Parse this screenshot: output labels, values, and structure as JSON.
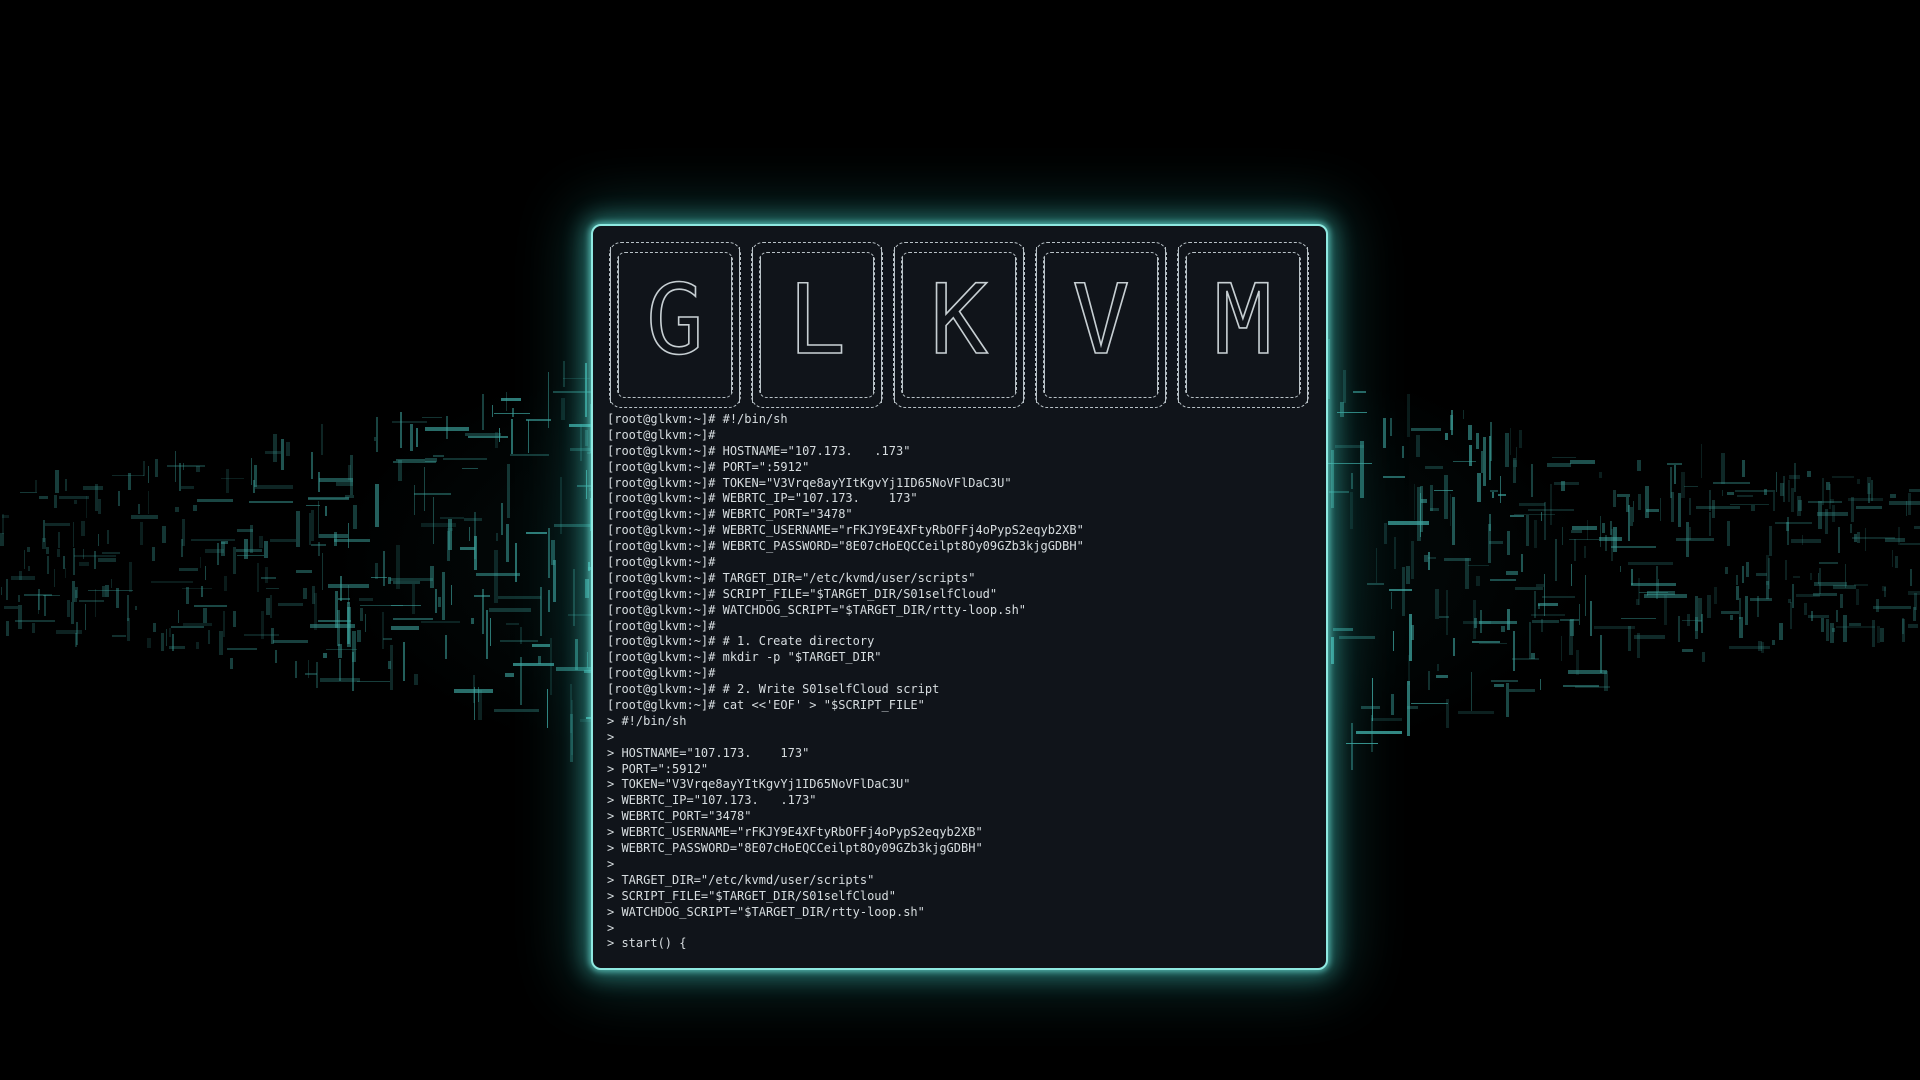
{
  "background": {
    "accent": "#3fa9a3",
    "glow": "#8fe9e1"
  },
  "terminal": {
    "background": "#10141a",
    "banner_letters": [
      "G",
      "L",
      "K",
      "V",
      "M"
    ],
    "lines": [
      "[root@glkvm:~]# #!/bin/sh",
      "[root@glkvm:~]#",
      "[root@glkvm:~]# HOSTNAME=\"107.173.   .173\"",
      "[root@glkvm:~]# PORT=\":5912\"",
      "[root@glkvm:~]# TOKEN=\"V3Vrqe8ayYItKgvYj1ID65NoVFlDaC3U\"",
      "[root@glkvm:~]# WEBRTC_IP=\"107.173.    173\"",
      "[root@glkvm:~]# WEBRTC_PORT=\"3478\"",
      "[root@glkvm:~]# WEBRTC_USERNAME=\"rFKJY9E4XFtyRbOFFj4oPypS2eqyb2XB\"",
      "[root@glkvm:~]# WEBRTC_PASSWORD=\"8E07cHoEQCCeilpt8Oy09GZb3kjgGDBH\"",
      "[root@glkvm:~]#",
      "[root@glkvm:~]# TARGET_DIR=\"/etc/kvmd/user/scripts\"",
      "[root@glkvm:~]# SCRIPT_FILE=\"$TARGET_DIR/S01selfCloud\"",
      "[root@glkvm:~]# WATCHDOG_SCRIPT=\"$TARGET_DIR/rtty-loop.sh\"",
      "[root@glkvm:~]#",
      "[root@glkvm:~]# # 1. Create directory",
      "[root@glkvm:~]# mkdir -p \"$TARGET_DIR\"",
      "[root@glkvm:~]#",
      "[root@glkvm:~]# # 2. Write S01selfCloud script",
      "[root@glkvm:~]# cat <<'EOF' > \"$SCRIPT_FILE\"",
      "> #!/bin/sh",
      ">",
      "> HOSTNAME=\"107.173.    173\"",
      "> PORT=\":5912\"",
      "> TOKEN=\"V3Vrqe8ayYItKgvYj1ID65NoVFlDaC3U\"",
      "> WEBRTC_IP=\"107.173.   .173\"",
      "> WEBRTC_PORT=\"3478\"",
      "> WEBRTC_USERNAME=\"rFKJY9E4XFtyRbOFFj4oPypS2eqyb2XB\"",
      "> WEBRTC_PASSWORD=\"8E07cHoEQCCeilpt8Oy09GZb3kjgGDBH\"",
      ">",
      "> TARGET_DIR=\"/etc/kvmd/user/scripts\"",
      "> SCRIPT_FILE=\"$TARGET_DIR/S01selfCloud\"",
      "> WATCHDOG_SCRIPT=\"$TARGET_DIR/rtty-loop.sh\"",
      ">",
      "> start() {"
    ]
  }
}
